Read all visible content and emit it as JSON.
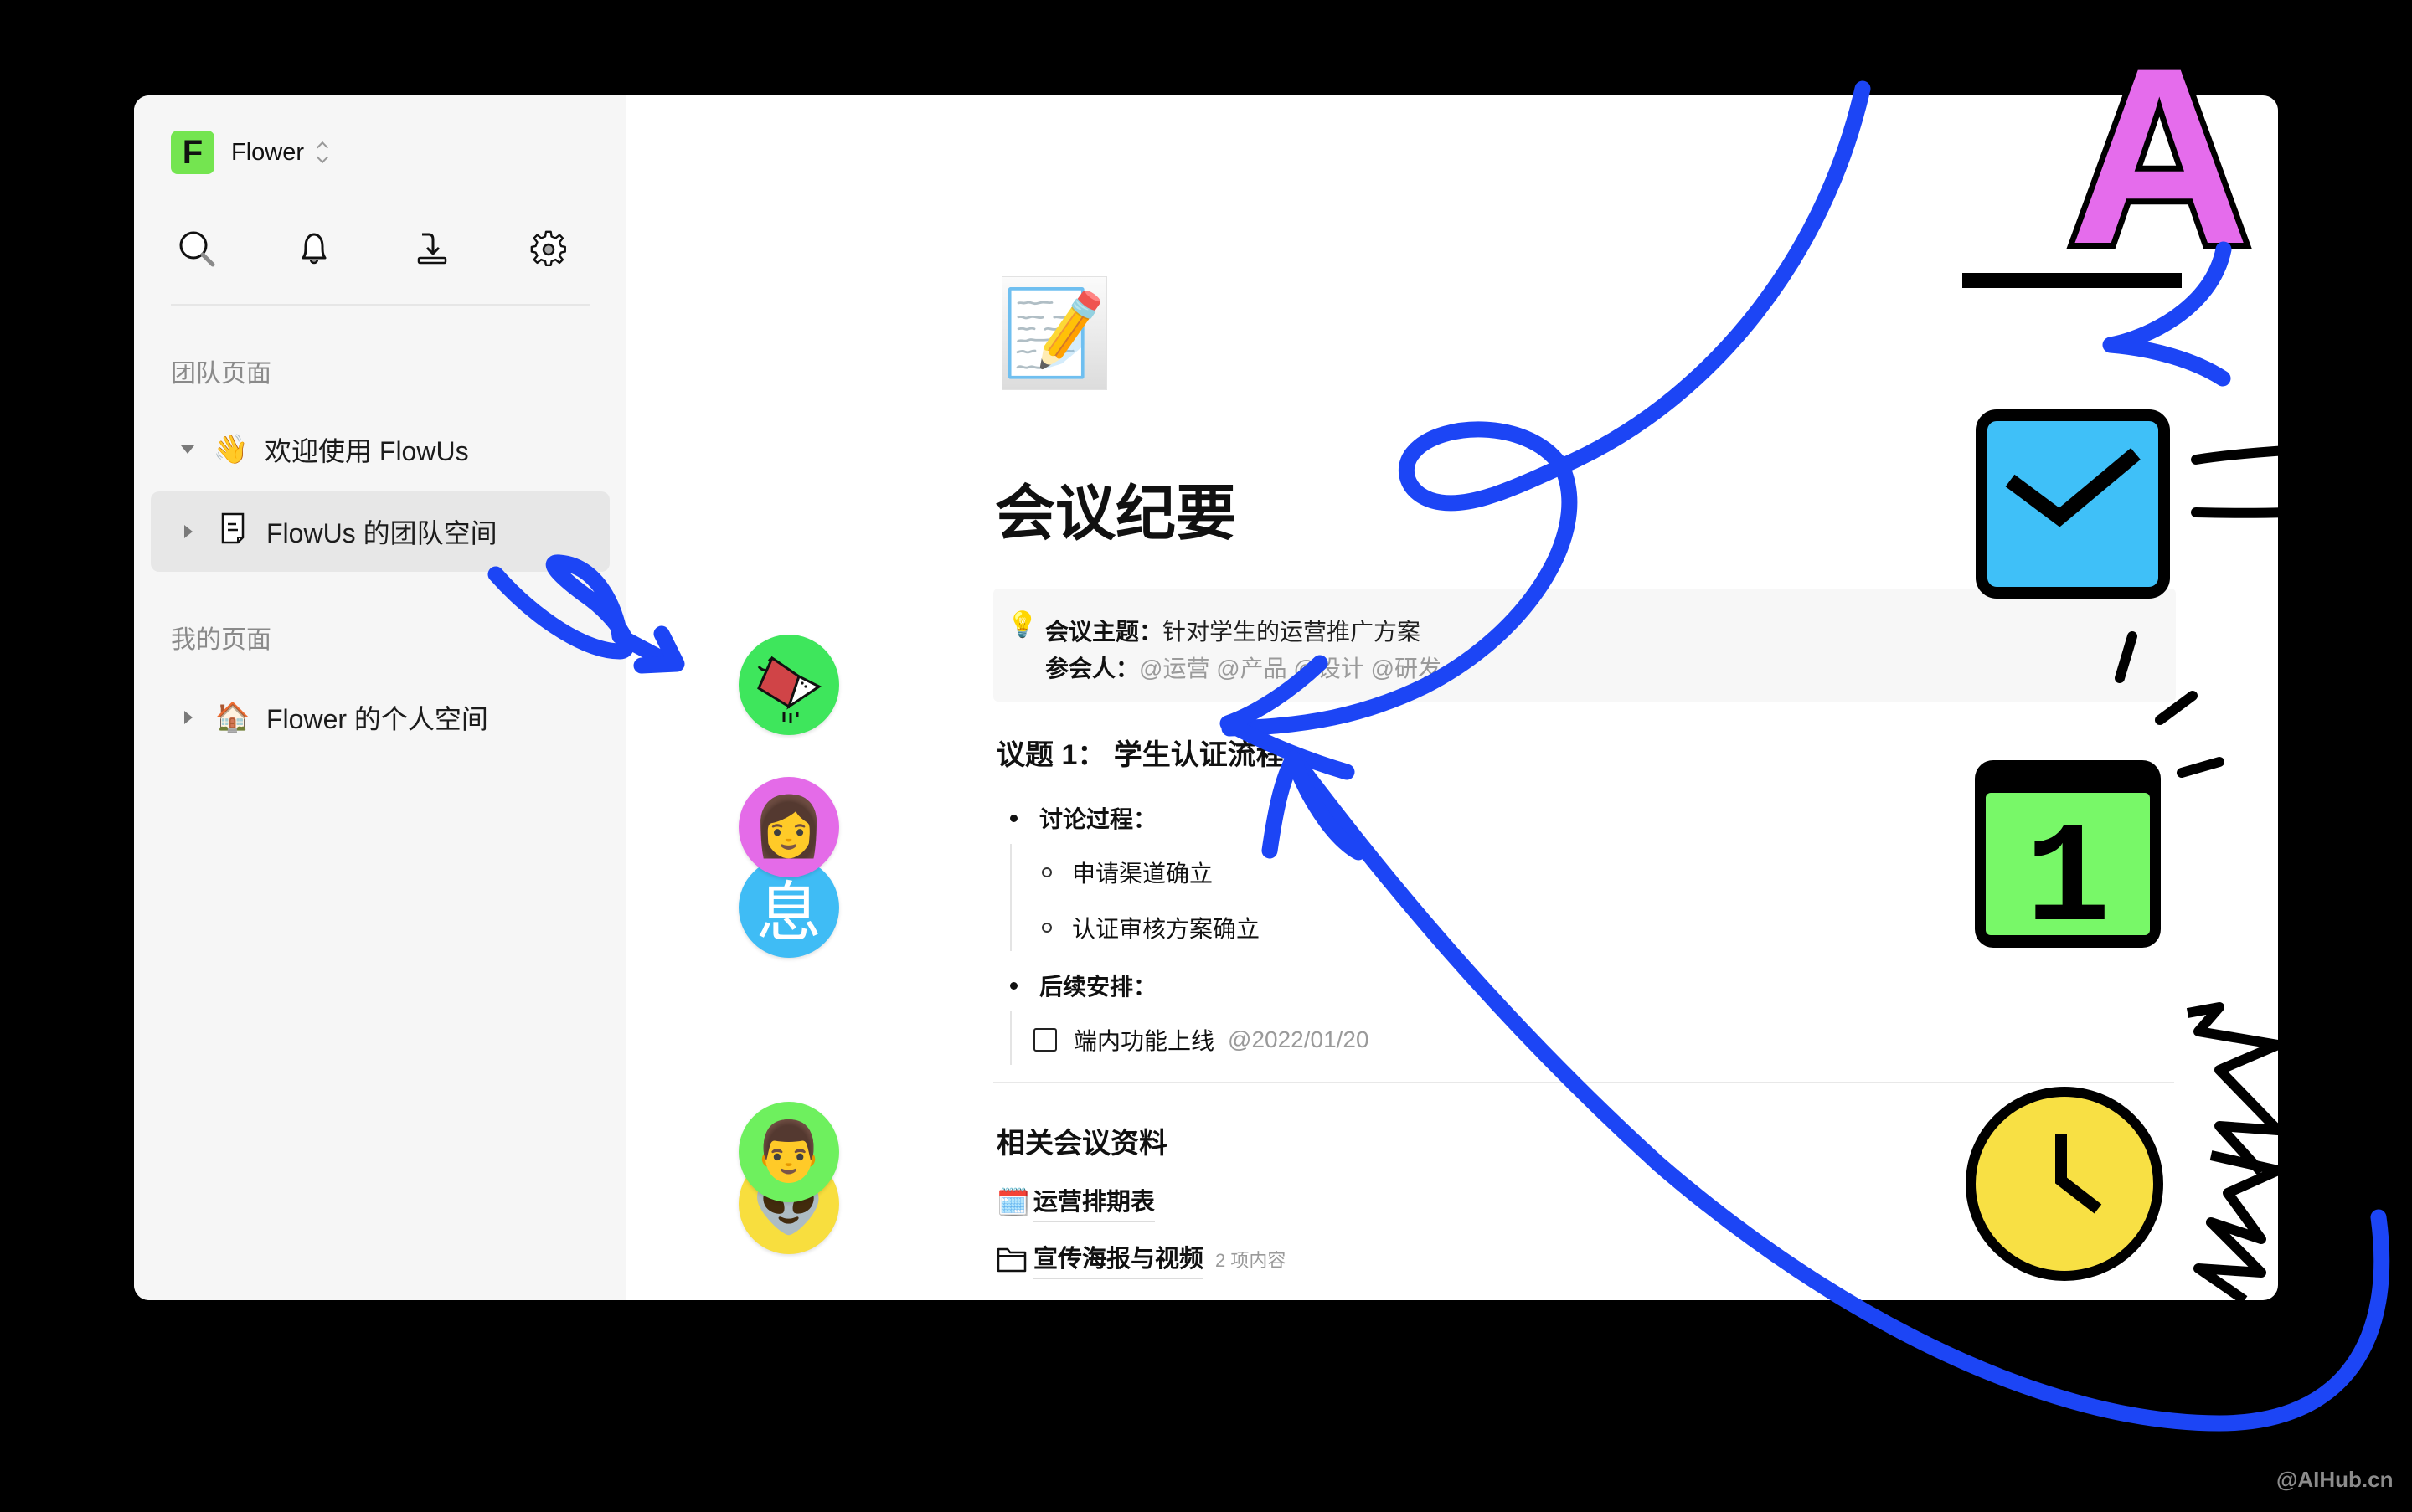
{
  "workspace": {
    "logo_letter": "F",
    "name": "Flower",
    "logo_color": "#74e550"
  },
  "toolbar": {
    "icons": [
      "search-icon",
      "bell-icon",
      "import-icon",
      "gear-icon"
    ]
  },
  "sidebar": {
    "team_section_label": "团队页面",
    "my_section_label": "我的页面",
    "items": [
      {
        "emoji": "👋",
        "label": "欢迎使用 FlowUs",
        "expanded": true
      },
      {
        "emoji": "📄",
        "label": "FlowUs 的团队空间",
        "expanded": false,
        "active": true
      },
      {
        "emoji": "🏠",
        "label": "Flower 的个人空间",
        "expanded": false
      }
    ]
  },
  "page": {
    "emoji": "📝",
    "title": "会议纪要",
    "callout": {
      "icon": "💡",
      "topic_label": "会议主题：",
      "topic_value": "针对学生的运营推广方案",
      "attendees_label": "参会人：",
      "attendees_value": "@运营 @产品 @设计 @研发"
    },
    "agenda_heading": "议题 1： 学生认证流程",
    "discussion_label": "讨论过程：",
    "discussion_items": [
      "申请渠道确立",
      "认证审核方案确立"
    ],
    "followup_label": "后续安排：",
    "todo": {
      "text": "端内功能上线",
      "date": "@2022/01/20",
      "checked": false
    },
    "related_heading": "相关会议资料",
    "links": [
      {
        "icon": "🗓️",
        "label": "运营排期表",
        "count": ""
      },
      {
        "icon": "folder-icon",
        "label": "宣传海报与视频",
        "count": "2 项内容"
      }
    ]
  },
  "avatars": [
    {
      "kind": "bird-drawing",
      "bg": "#3ee65c"
    },
    {
      "kind": "emoji",
      "content": "👩",
      "bg": "#e46be8"
    },
    {
      "kind": "text",
      "content": "息",
      "bg": "#3fbcf5"
    },
    {
      "kind": "emoji",
      "content": "👨",
      "bg": "#6ef05e"
    },
    {
      "kind": "emoji",
      "content": "👽",
      "bg": "#f8de3e"
    }
  ],
  "decorations": {
    "text_style_letter": "A",
    "calendar_number": "1",
    "colors": {
      "stroke_blue": "#1c45f5",
      "magenta": "#e56cec",
      "sky": "#3fc0f8",
      "green": "#78f868",
      "yellow": "#f8e044"
    }
  },
  "watermark": "@AIHub.cn"
}
